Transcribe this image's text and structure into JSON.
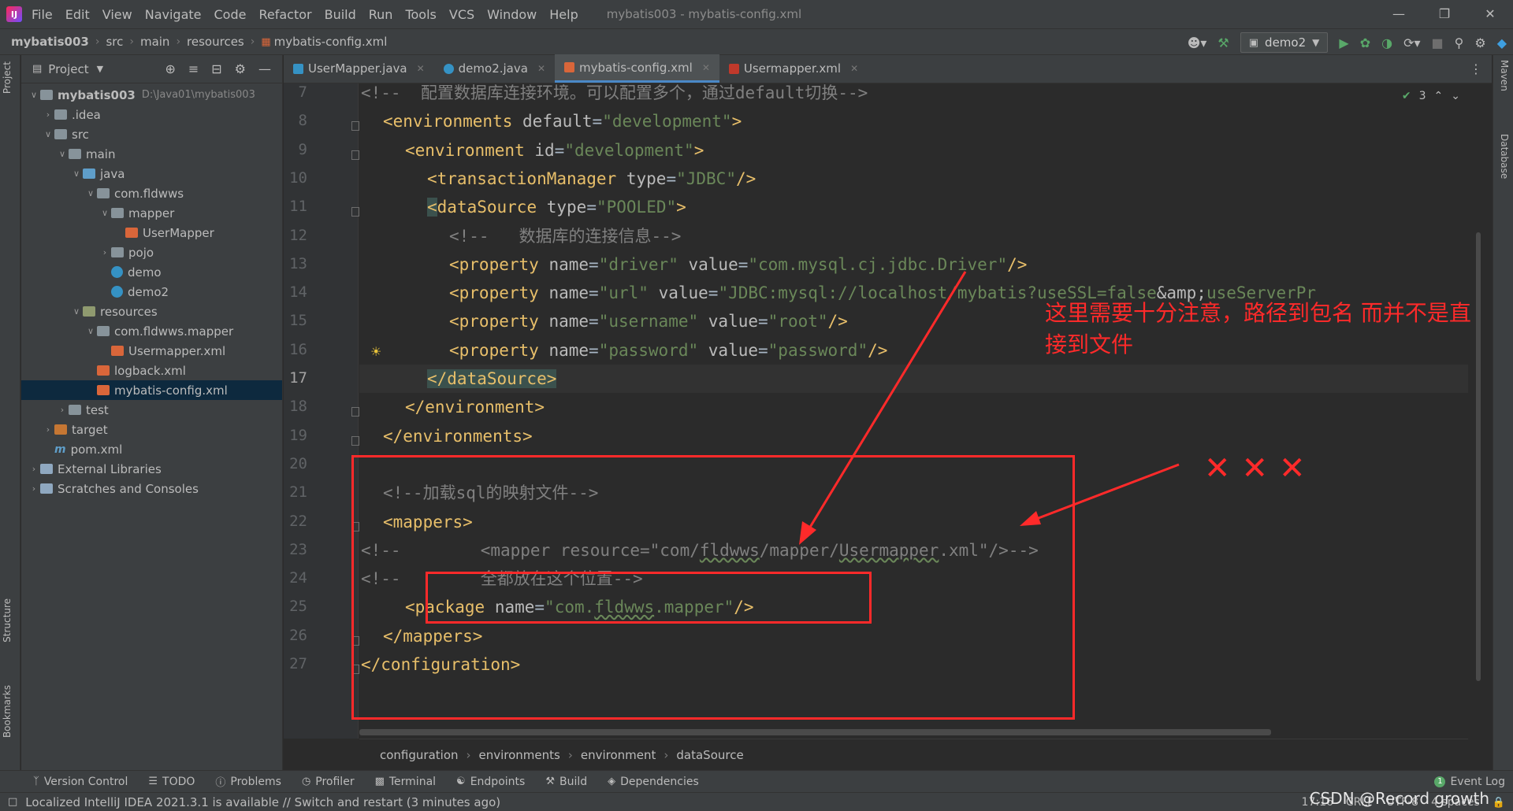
{
  "menubar": {
    "items": [
      "File",
      "Edit",
      "View",
      "Navigate",
      "Code",
      "Refactor",
      "Build",
      "Run",
      "Tools",
      "VCS",
      "Window",
      "Help"
    ],
    "window_title": "mybatis003 - mybatis-config.xml"
  },
  "navbar": {
    "crumbs": [
      "mybatis003",
      "src",
      "main",
      "resources",
      "mybatis-config.xml"
    ],
    "run_config": "demo2"
  },
  "left_strip": {
    "project": "Project",
    "structure": "Structure",
    "bookmarks": "Bookmarks"
  },
  "right_strip": {
    "maven": "Maven",
    "database": "Database"
  },
  "project_panel": {
    "title": "Project",
    "tree": [
      {
        "label": "mybatis003",
        "path": "D:\\Java01\\mybatis003",
        "indent": 0,
        "arrow": "v",
        "icon": "folder"
      },
      {
        "label": ".idea",
        "indent": 1,
        "arrow": ">",
        "icon": "folder"
      },
      {
        "label": "src",
        "indent": 1,
        "arrow": "v",
        "icon": "folder"
      },
      {
        "label": "main",
        "indent": 2,
        "arrow": "v",
        "icon": "folder"
      },
      {
        "label": "java",
        "indent": 3,
        "arrow": "v",
        "icon": "folder-blue"
      },
      {
        "label": "com.fldwws",
        "indent": 4,
        "arrow": "v",
        "icon": "folder"
      },
      {
        "label": "mapper",
        "indent": 5,
        "arrow": "v",
        "icon": "folder"
      },
      {
        "label": "UserMapper",
        "indent": 6,
        "arrow": "",
        "icon": "mapper"
      },
      {
        "label": "pojo",
        "indent": 5,
        "arrow": ">",
        "icon": "folder"
      },
      {
        "label": "demo",
        "indent": 5,
        "arrow": "",
        "icon": "class"
      },
      {
        "label": "demo2",
        "indent": 5,
        "arrow": "",
        "icon": "class"
      },
      {
        "label": "resources",
        "indent": 3,
        "arrow": "v",
        "icon": "folder-res"
      },
      {
        "label": "com.fldwws.mapper",
        "indent": 4,
        "arrow": "v",
        "icon": "folder"
      },
      {
        "label": "Usermapper.xml",
        "indent": 5,
        "arrow": "",
        "icon": "mapper"
      },
      {
        "label": "logback.xml",
        "indent": 4,
        "arrow": "",
        "icon": "xml"
      },
      {
        "label": "mybatis-config.xml",
        "indent": 4,
        "arrow": "",
        "icon": "xml",
        "selected": true
      },
      {
        "label": "test",
        "indent": 2,
        "arrow": ">",
        "icon": "folder"
      },
      {
        "label": "target",
        "indent": 1,
        "arrow": ">",
        "icon": "folder-orange"
      },
      {
        "label": "pom.xml",
        "indent": 1,
        "arrow": "",
        "icon": "maven"
      },
      {
        "label": "External Libraries",
        "indent": 0,
        "arrow": ">",
        "icon": "lib"
      },
      {
        "label": "Scratches and Consoles",
        "indent": 0,
        "arrow": ">",
        "icon": "scratch"
      }
    ]
  },
  "tabs": [
    {
      "label": "UserMapper.java",
      "active": false
    },
    {
      "label": "demo2.java",
      "active": false
    },
    {
      "label": "mybatis-config.xml",
      "active": true
    },
    {
      "label": "Usermapper.xml",
      "active": false
    }
  ],
  "editor": {
    "inspection_count": "3",
    "current_line": 17,
    "lines": [
      {
        "n": 7,
        "html": "<span class='cm'>&lt;!--  配置数据库连接环境。可以配置多个，通过default切换--&gt;</span>",
        "indent": 0
      },
      {
        "n": 8,
        "html": "<span class='tg'>&lt;environments</span> <span class='at'>default</span>=<span class='vl'>\"development\"</span><span class='tg'>&gt;</span>",
        "indent": 2
      },
      {
        "n": 9,
        "html": "<span class='tg'>&lt;environment</span> <span class='at'>id</span>=<span class='vl'>\"development\"</span><span class='tg'>&gt;</span>",
        "indent": 4
      },
      {
        "n": 10,
        "html": "<span class='tg'>&lt;transactionManager</span> <span class='at'>type</span>=<span class='vl'>\"JDBC\"</span><span class='tg'>/&gt;</span>",
        "indent": 6
      },
      {
        "n": 11,
        "html": "<span class='tg hl'>&lt;</span><span class='tg'>dataSource</span> <span class='at'>type</span>=<span class='vl'>\"POOLED\"</span><span class='tg'>&gt;</span>",
        "indent": 6
      },
      {
        "n": 12,
        "html": "<span class='cm'>&lt;!--   数据库的连接信息--&gt;</span>",
        "indent": 8
      },
      {
        "n": 13,
        "html": "<span class='tg'>&lt;property</span> <span class='at'>name</span>=<span class='vl'>\"driver\"</span> <span class='at'>value</span>=<span class='vl'>\"com.mysql.cj.jdbc.Driver\"</span><span class='tg'>/&gt;</span>",
        "indent": 8
      },
      {
        "n": 14,
        "html": "<span class='tg'>&lt;property</span> <span class='at'>name</span>=<span class='vl'>\"url\"</span> <span class='at'>value</span>=<span class='vl'>\"JDBC:mysql://localhost/mybatis?useSSL=false<span class='at'>&amp;amp;</span>useServerPr</span>",
        "indent": 8
      },
      {
        "n": 15,
        "html": "<span class='tg'>&lt;property</span> <span class='at'>name</span>=<span class='vl'>\"username\"</span> <span class='at'>value</span>=<span class='vl'>\"root\"</span><span class='tg'>/&gt;</span>",
        "indent": 8
      },
      {
        "n": 16,
        "html": "<span class='tg'>&lt;property</span> <span class='at'>name</span>=<span class='vl'>\"password\"</span> <span class='at'>value</span>=<span class='vl'>\"password\"</span><span class='tg'>/&gt;</span>",
        "indent": 8
      },
      {
        "n": 17,
        "html": "<span class='tg hl'>&lt;/dataSource&gt;</span>",
        "indent": 6
      },
      {
        "n": 18,
        "html": "<span class='tg'>&lt;/environment&gt;</span>",
        "indent": 4
      },
      {
        "n": 19,
        "html": "<span class='tg'>&lt;/environments&gt;</span>",
        "indent": 2
      },
      {
        "n": 20,
        "html": "",
        "indent": 0
      },
      {
        "n": 21,
        "html": "<span class='cm'>&lt;!--加载sql的映射文件--&gt;</span>",
        "indent": 2
      },
      {
        "n": 22,
        "html": "<span class='tg'>&lt;mappers&gt;</span>",
        "indent": 2
      },
      {
        "n": 23,
        "html": "<span class='cm'>&lt;!--        &lt;mapper resource=\"com/<span class='ul'>fldwws</span>/mapper/<span class='ul'>Usermapper</span>.xml\"/&gt;--&gt;</span>",
        "indent": 0
      },
      {
        "n": 24,
        "html": "<span class='cm'>&lt;!--        全都放在这个位置--&gt;</span>",
        "indent": 0
      },
      {
        "n": 25,
        "html": "<span class='tg'>&lt;package</span> <span class='at'>name</span>=<span class='vl'>\"com.<span class='ul'>fldwws</span>.mapper\"</span><span class='tg'>/&gt;</span>",
        "indent": 4
      },
      {
        "n": 26,
        "html": "<span class='tg'>&lt;/mappers&gt;</span>",
        "indent": 2
      },
      {
        "n": 27,
        "html": "<span class='tg'>&lt;/configuration&gt;</span>",
        "indent": 0
      }
    ]
  },
  "annotation": {
    "note_line1": "这里需要十分注意，路径到包名 而并不是直",
    "note_line2": "接到文件",
    "crosses": "✕✕✕",
    "color": "#ff2a2a"
  },
  "editor_breadcrumb": [
    "configuration",
    "environments",
    "environment",
    "dataSource"
  ],
  "bottom_tools": [
    "Version Control",
    "TODO",
    "Problems",
    "Profiler",
    "Terminal",
    "Endpoints",
    "Build",
    "Dependencies"
  ],
  "event_log": "Event Log",
  "event_log_count": "1",
  "status": {
    "message": "Localized IntelliJ IDEA 2021.3.1 is available // Switch and restart (3 minutes ago)",
    "position": "17:16",
    "line_sep": "CRLF",
    "encoding": "UTF-8",
    "indent": "4 spaces"
  },
  "watermark": "CSDN @Record growth"
}
